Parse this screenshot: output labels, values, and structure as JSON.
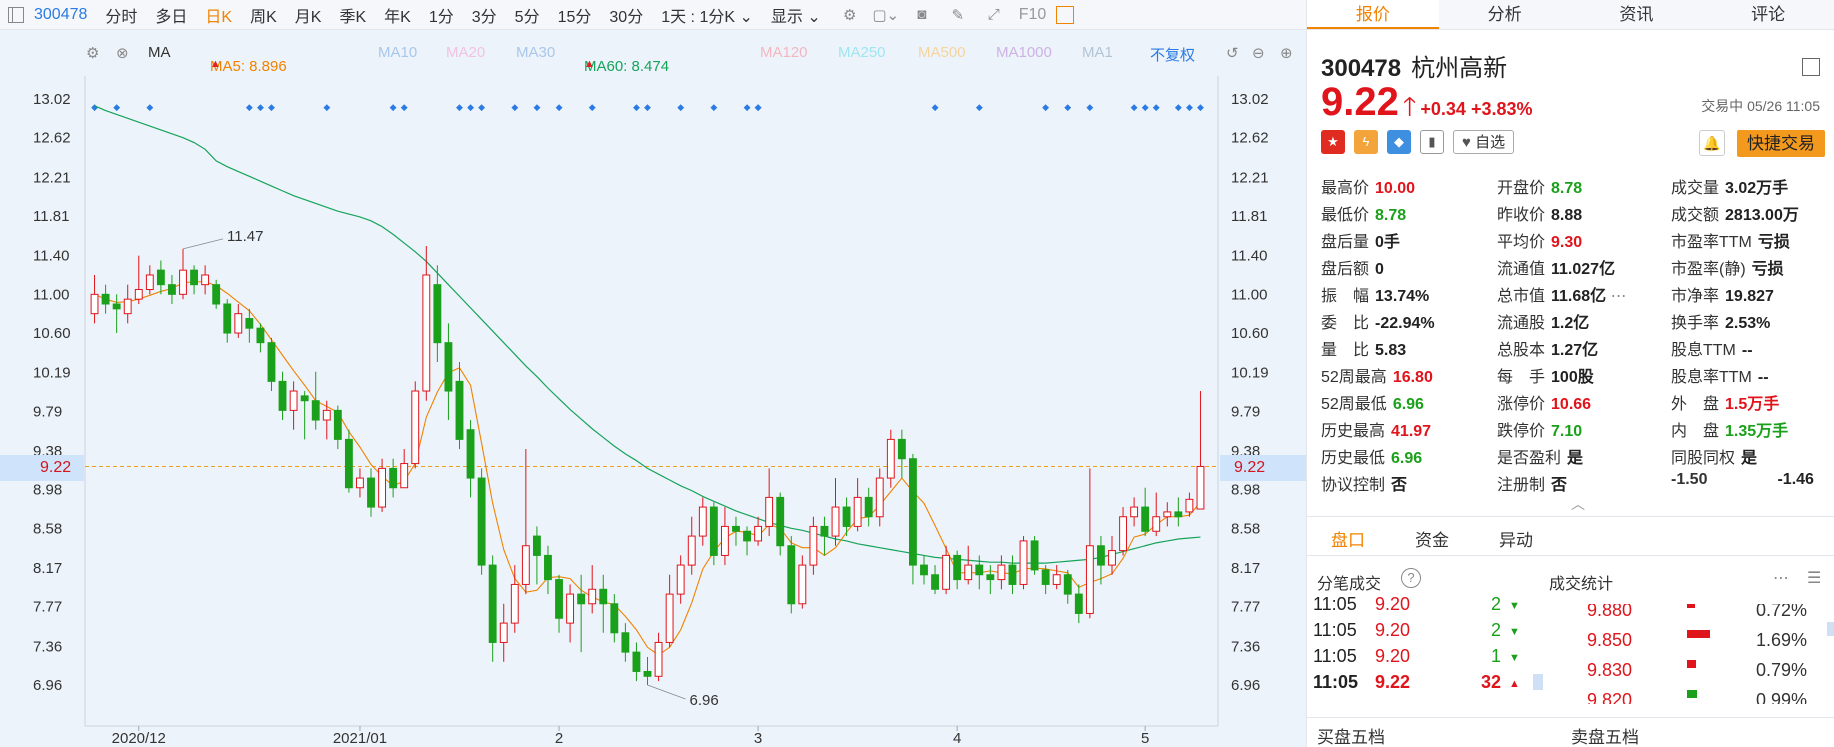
{
  "toolbar": {
    "code": "300478",
    "periods": [
      "分时",
      "多日",
      "日K",
      "周K",
      "月K",
      "季K",
      "年K",
      "1分",
      "3分",
      "5分",
      "15分",
      "30分"
    ],
    "active_period": "日K",
    "interval_select": "1天 : 1分K",
    "display_select": "显示",
    "f10": "F10"
  },
  "ma": {
    "label": "MA",
    "ma5": "MA5: 8.896",
    "ma10": "MA10",
    "ma20": "MA20",
    "ma30": "MA30",
    "ma60": "MA60: 8.474",
    "ma120": "MA120",
    "ma250": "MA250",
    "ma500": "MA500",
    "ma1000": "MA1000",
    "ma1": "MA1",
    "fq": "不复权",
    "colors": {
      "ma5": "#f08300",
      "ma10": "#7aa7de",
      "ma20": "#e9a6d8",
      "ma30": "#7aa7de",
      "ma60": "#16a35a",
      "ma120": "#f4a7b0",
      "ma250": "#8fe0ee",
      "ma500": "#f5cf8e",
      "ma1000": "#c6a6e0",
      "ma1": "#9fb3cc"
    }
  },
  "axis": {
    "y_ticks": [
      "13.02",
      "12.62",
      "12.21",
      "11.81",
      "11.40",
      "11.00",
      "10.60",
      "10.19",
      "9.79",
      "9.38",
      "8.98",
      "8.58",
      "8.17",
      "7.77",
      "7.36",
      "6.96"
    ],
    "current_price": "9.22",
    "x_ticks": [
      "2020/12",
      "2021/01",
      "2",
      "3",
      "4",
      "5"
    ],
    "high_label": "11.47",
    "low_label": "6.96"
  },
  "chart_data": {
    "type": "candlestick",
    "ylim": [
      6.75,
      13.2
    ],
    "current_price": 9.22,
    "ma60": [
      12.95,
      12.9,
      12.86,
      12.82,
      12.78,
      12.74,
      12.7,
      12.66,
      12.62,
      12.57,
      12.5,
      12.38,
      12.32,
      12.27,
      12.22,
      12.17,
      12.12,
      12.07,
      12.02,
      11.98,
      11.94,
      11.9,
      11.86,
      11.83,
      11.8,
      11.76,
      11.7,
      11.62,
      11.53,
      11.44,
      11.34,
      11.22,
      11.1,
      10.98,
      10.86,
      10.74,
      10.62,
      10.5,
      10.38,
      10.26,
      10.15,
      10.03,
      9.92,
      9.81,
      9.71,
      9.61,
      9.52,
      9.43,
      9.35,
      9.28,
      9.2,
      9.14,
      9.08,
      9.02,
      8.97,
      8.91,
      8.86,
      8.81,
      8.76,
      8.72,
      8.68,
      8.64,
      8.61,
      8.58,
      8.56,
      8.53,
      8.5,
      8.47,
      8.45,
      8.42,
      8.4,
      8.38,
      8.36,
      8.34,
      8.32,
      8.3,
      8.28,
      8.27,
      8.26,
      8.25,
      8.24,
      8.23,
      8.23,
      8.22,
      8.22,
      8.22,
      8.22,
      8.23,
      8.24,
      8.25,
      8.26,
      8.28,
      8.31,
      8.34,
      8.37,
      8.4,
      8.43,
      8.45,
      8.47,
      8.48,
      8.49
    ],
    "candles": [
      [
        10.8,
        11.0,
        11.2,
        10.7
      ],
      [
        11.0,
        10.9,
        11.1,
        10.8
      ],
      [
        10.9,
        10.85,
        11.0,
        10.6
      ],
      [
        10.8,
        10.95,
        11.1,
        10.7
      ],
      [
        10.95,
        11.05,
        11.4,
        10.9
      ],
      [
        11.05,
        11.2,
        11.3,
        11.0
      ],
      [
        11.25,
        11.1,
        11.35,
        11.0
      ],
      [
        11.1,
        11.0,
        11.2,
        10.9
      ],
      [
        11.0,
        11.25,
        11.47,
        10.95
      ],
      [
        11.25,
        11.1,
        11.3,
        11.0
      ],
      [
        11.1,
        11.2,
        11.3,
        11.0
      ],
      [
        11.1,
        10.9,
        11.15,
        10.85
      ],
      [
        10.9,
        10.6,
        10.95,
        10.5
      ],
      [
        10.6,
        10.8,
        10.9,
        10.55
      ],
      [
        10.75,
        10.65,
        10.85,
        10.5
      ],
      [
        10.65,
        10.5,
        10.7,
        10.4
      ],
      [
        10.5,
        10.1,
        10.55,
        10.0
      ],
      [
        10.1,
        9.8,
        10.2,
        9.7
      ],
      [
        9.8,
        10.0,
        10.1,
        9.6
      ],
      [
        9.95,
        9.9,
        10.0,
        9.5
      ],
      [
        9.9,
        9.7,
        10.2,
        9.6
      ],
      [
        9.7,
        9.8,
        9.9,
        9.5
      ],
      [
        9.8,
        9.5,
        9.85,
        9.4
      ],
      [
        9.5,
        9.0,
        9.6,
        8.95
      ],
      [
        9.0,
        9.1,
        9.2,
        8.9
      ],
      [
        9.1,
        8.8,
        9.2,
        8.7
      ],
      [
        8.8,
        9.2,
        9.3,
        8.75
      ],
      [
        9.2,
        9.0,
        9.3,
        8.9
      ],
      [
        9.0,
        9.25,
        9.4,
        9.0
      ],
      [
        9.25,
        10.0,
        10.1,
        9.2
      ],
      [
        10.0,
        11.2,
        11.5,
        9.9
      ],
      [
        11.1,
        10.5,
        11.3,
        10.3
      ],
      [
        10.5,
        10.0,
        10.7,
        9.7
      ],
      [
        10.1,
        9.5,
        10.3,
        9.4
      ],
      [
        9.6,
        9.1,
        9.7,
        8.9
      ],
      [
        9.1,
        8.2,
        9.2,
        8.1
      ],
      [
        8.2,
        7.4,
        8.3,
        7.2
      ],
      [
        7.4,
        7.6,
        7.8,
        7.2
      ],
      [
        7.6,
        8.0,
        8.2,
        7.5
      ],
      [
        8.0,
        8.4,
        9.4,
        7.9
      ],
      [
        8.5,
        8.3,
        8.6,
        8.0
      ],
      [
        8.3,
        8.05,
        8.4,
        7.9
      ],
      [
        8.05,
        7.65,
        8.1,
        7.5
      ],
      [
        7.6,
        7.9,
        8.0,
        7.4
      ],
      [
        7.9,
        7.8,
        8.1,
        7.3
      ],
      [
        7.8,
        7.95,
        8.2,
        7.7
      ],
      [
        7.95,
        7.8,
        8.1,
        7.5
      ],
      [
        7.8,
        7.5,
        7.9,
        7.4
      ],
      [
        7.5,
        7.3,
        7.6,
        7.2
      ],
      [
        7.3,
        7.1,
        7.4,
        7.0
      ],
      [
        7.1,
        7.05,
        7.25,
        6.96
      ],
      [
        7.05,
        7.4,
        7.5,
        7.0
      ],
      [
        7.4,
        7.9,
        8.1,
        7.35
      ],
      [
        7.9,
        8.2,
        8.3,
        7.8
      ],
      [
        8.2,
        8.5,
        8.7,
        8.1
      ],
      [
        8.5,
        8.8,
        8.9,
        8.4
      ],
      [
        8.8,
        8.3,
        8.85,
        8.2
      ],
      [
        8.3,
        8.6,
        8.8,
        8.2
      ],
      [
        8.6,
        8.55,
        8.7,
        8.4
      ],
      [
        8.55,
        8.45,
        8.6,
        8.3
      ],
      [
        8.45,
        8.6,
        8.7,
        8.4
      ],
      [
        8.6,
        8.9,
        9.2,
        8.5
      ],
      [
        8.9,
        8.4,
        8.95,
        8.3
      ],
      [
        8.4,
        7.8,
        8.5,
        7.7
      ],
      [
        7.8,
        8.2,
        8.3,
        7.75
      ],
      [
        8.2,
        8.6,
        8.7,
        8.1
      ],
      [
        8.6,
        8.5,
        8.7,
        8.3
      ],
      [
        8.5,
        8.8,
        9.1,
        8.4
      ],
      [
        8.8,
        8.6,
        8.9,
        8.5
      ],
      [
        8.6,
        8.9,
        9.1,
        8.55
      ],
      [
        8.9,
        8.7,
        9.0,
        8.6
      ],
      [
        8.7,
        9.1,
        9.2,
        8.6
      ],
      [
        9.1,
        9.5,
        9.6,
        9.0
      ],
      [
        9.5,
        9.3,
        9.6,
        9.1
      ],
      [
        9.3,
        8.2,
        9.35,
        8.0
      ],
      [
        8.2,
        8.1,
        8.3,
        8.0
      ],
      [
        8.1,
        7.95,
        8.2,
        7.9
      ],
      [
        7.95,
        8.3,
        8.4,
        7.9
      ],
      [
        8.3,
        8.05,
        8.35,
        7.95
      ],
      [
        8.05,
        8.2,
        8.4,
        8.0
      ],
      [
        8.2,
        8.1,
        8.3,
        7.95
      ],
      [
        8.1,
        8.05,
        8.2,
        7.9
      ],
      [
        8.05,
        8.2,
        8.3,
        7.95
      ],
      [
        8.2,
        8.0,
        8.3,
        7.9
      ],
      [
        8.0,
        8.45,
        8.5,
        7.95
      ],
      [
        8.45,
        8.15,
        8.5,
        8.1
      ],
      [
        8.15,
        8.0,
        8.2,
        7.9
      ],
      [
        8.0,
        8.1,
        8.2,
        7.95
      ],
      [
        8.1,
        7.9,
        8.15,
        7.8
      ],
      [
        7.9,
        7.7,
        8.0,
        7.6
      ],
      [
        7.7,
        8.4,
        9.2,
        7.65
      ],
      [
        8.4,
        8.2,
        8.5,
        8.0
      ],
      [
        8.2,
        8.35,
        8.5,
        8.1
      ],
      [
        8.35,
        8.7,
        8.8,
        8.3
      ],
      [
        8.7,
        8.8,
        8.9,
        8.6
      ],
      [
        8.8,
        8.55,
        9.0,
        8.5
      ],
      [
        8.55,
        8.7,
        8.95,
        8.5
      ],
      [
        8.7,
        8.75,
        8.85,
        8.6
      ],
      [
        8.75,
        8.7,
        8.9,
        8.6
      ],
      [
        8.75,
        8.88,
        8.95,
        8.7
      ],
      [
        8.78,
        9.22,
        10.0,
        8.78
      ]
    ]
  },
  "right": {
    "tabs": [
      "报价",
      "分析",
      "资讯",
      "评论"
    ],
    "active_tab": "报价",
    "code": "300478",
    "name": "杭州高新",
    "price": "9.22",
    "change": "+0.34",
    "change_pct": "+3.83%",
    "status": "交易中 05/26 11:05",
    "fav": "自选",
    "quick_trade": "快捷交易",
    "stats": [
      [
        [
          "最高价",
          "10.00",
          "red"
        ],
        [
          "开盘价",
          "8.78",
          "green"
        ],
        [
          "成交量",
          "3.02万手",
          "blk"
        ]
      ],
      [
        [
          "最低价",
          "8.78",
          "green"
        ],
        [
          "昨收价",
          "8.88",
          "blk"
        ],
        [
          "成交额",
          "2813.00万",
          "blk"
        ]
      ],
      [
        [
          "盘后量",
          "0手",
          "blk"
        ],
        [
          "平均价",
          "9.30",
          "red"
        ],
        [
          "市盈率TTM",
          "亏损",
          "blk"
        ]
      ],
      [
        [
          "盘后额",
          "0",
          "blk"
        ],
        [
          "流通值",
          "11.027亿",
          "blk"
        ],
        [
          "市盈率(静)",
          "亏损",
          "blk"
        ]
      ],
      [
        [
          "振　幅",
          "13.74%",
          "blk"
        ],
        [
          "总市值",
          "11.68亿",
          "blk"
        ],
        [
          "市净率",
          "19.827",
          "blk"
        ]
      ],
      [
        [
          "委　比",
          "-22.94%",
          "blk"
        ],
        [
          "流通股",
          "1.2亿",
          "blk"
        ],
        [
          "换手率",
          "2.53%",
          "blk"
        ]
      ],
      [
        [
          "量　比",
          "5.83",
          "blk"
        ],
        [
          "总股本",
          "1.27亿",
          "blk"
        ],
        [
          "股息TTM",
          "--",
          "blk"
        ]
      ],
      [
        [
          "52周最高",
          "16.80",
          "red"
        ],
        [
          "每　手",
          "100股",
          "blk"
        ],
        [
          "股息率TTM",
          "--",
          "blk"
        ]
      ],
      [
        [
          "52周最低",
          "6.96",
          "green"
        ],
        [
          "涨停价",
          "10.66",
          "red"
        ],
        [
          "外　盘",
          "1.5万手",
          "red"
        ]
      ],
      [
        [
          "历史最高",
          "41.97",
          "red"
        ],
        [
          "跌停价",
          "7.10",
          "green"
        ],
        [
          "内　盘",
          "1.35万手",
          "green"
        ]
      ],
      [
        [
          "历史最低",
          "6.96",
          "green"
        ],
        [
          "是否盈利",
          "是",
          "blk"
        ],
        [
          "同股同权",
          "是",
          "blk"
        ]
      ],
      [
        [
          "协议控制",
          "否",
          "blk"
        ],
        [
          "注册制",
          "否",
          "blk"
        ],
        [
          "-1.50",
          "-1.46",
          "blk"
        ]
      ]
    ],
    "sub_tabs": [
      "盘口",
      "资金",
      "异动"
    ],
    "active_sub_tab": "盘口",
    "tick_header": "分笔成交",
    "stat_header": "成交统计",
    "trades": [
      [
        "11:05",
        "9.20",
        "2",
        "down"
      ],
      [
        "11:05",
        "9.20",
        "2",
        "down"
      ],
      [
        "11:05",
        "9.20",
        "1",
        "down"
      ],
      [
        "11:05",
        "9.22",
        "32",
        "up"
      ]
    ],
    "price_stats": [
      [
        "9.880",
        "0.72%",
        "red",
        0.15
      ],
      [
        "9.850",
        "1.69%",
        "red",
        0.45
      ],
      [
        "9.830",
        "0.79%",
        "red",
        0.17
      ],
      [
        "9.820",
        "0.99%",
        "green",
        0.2
      ]
    ],
    "buy5": "买盘五档",
    "sell5": "卖盘五档"
  }
}
